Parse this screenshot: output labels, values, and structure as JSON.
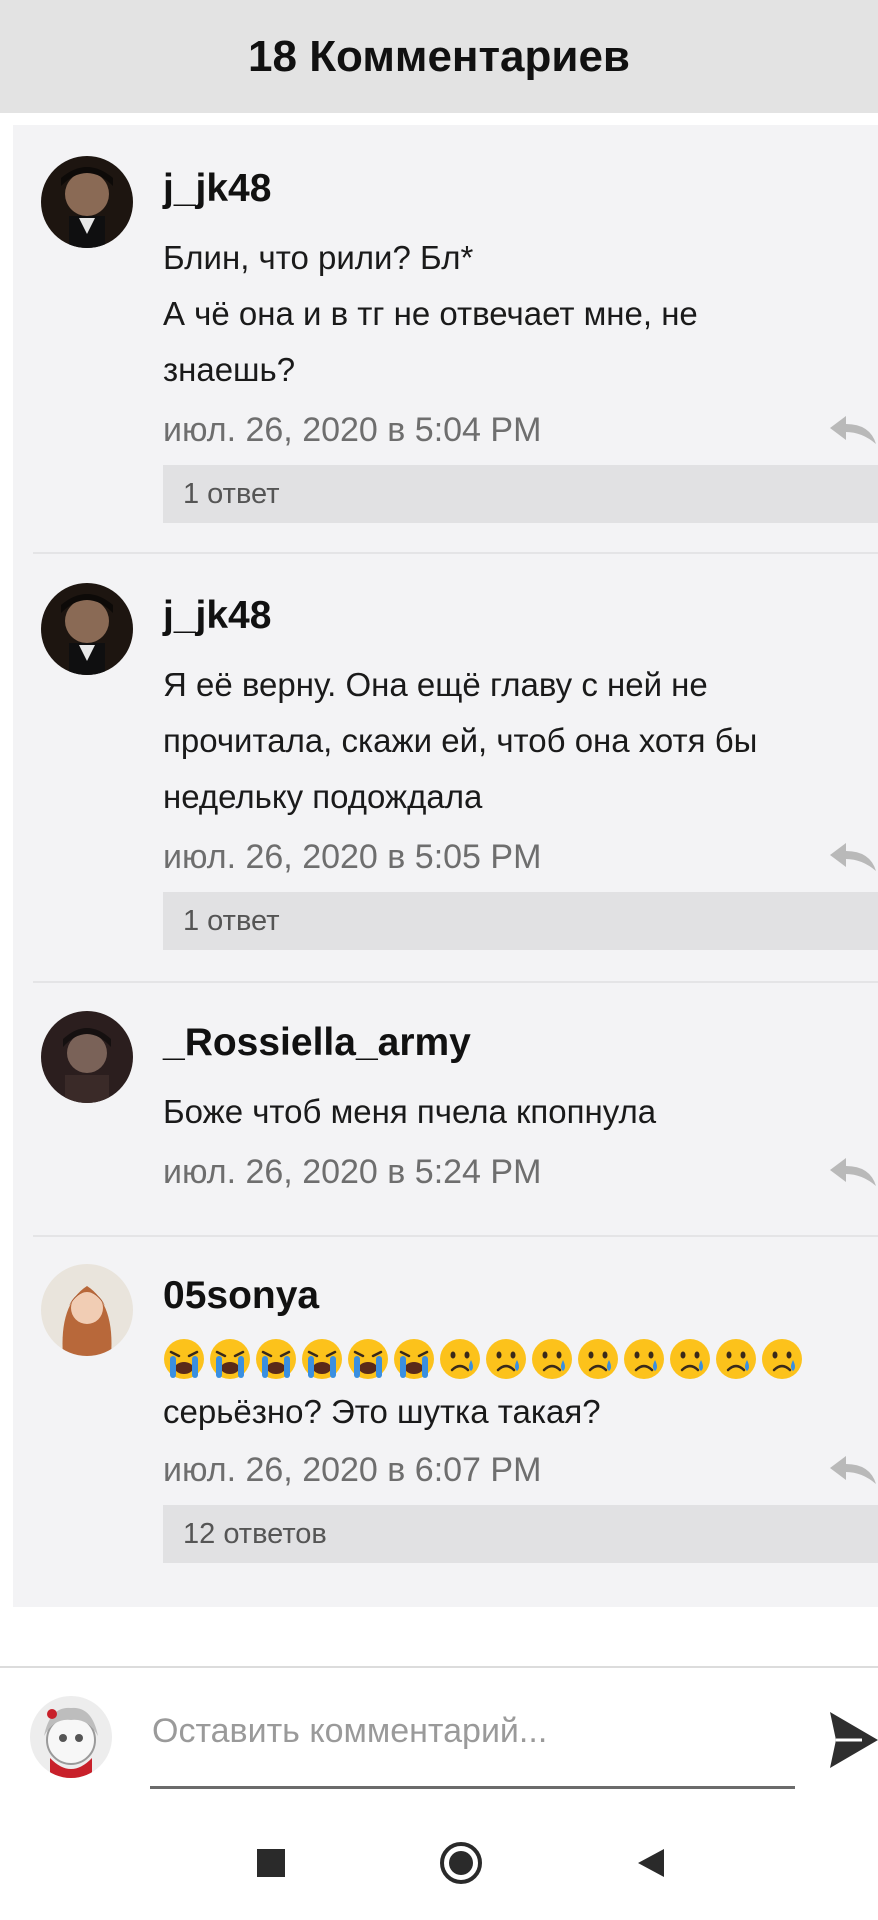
{
  "header": {
    "title": "18 Комментариев"
  },
  "comments": [
    {
      "username": "j_jk48",
      "lines": [
        "Блин, что рили? Бл*",
        "А чё она и в тг не отвечает мне, не",
        "знаешь?"
      ],
      "timestamp": "июл. 26, 2020 в 5:04 PM",
      "replies": "1 ответ"
    },
    {
      "username": "j_jk48",
      "lines": [
        "Я её верну. Она ещё главу с ней не",
        "прочитала, скажи ей, чтоб она хотя бы",
        "недельку подождала"
      ],
      "timestamp": "июл. 26, 2020 в 5:05 PM",
      "replies": "1 ответ"
    },
    {
      "username": "_Rossiella_army",
      "lines": [
        "Боже чтоб меня пчела кпопнула"
      ],
      "timestamp": "июл. 26, 2020 в 5:24 PM"
    },
    {
      "username": "05sonya",
      "emoji_row": [
        "😭",
        "😭",
        "😭",
        "😭",
        "😭",
        "😭",
        "😢",
        "😢",
        "😢",
        "😢",
        "😢",
        "😢",
        "😢",
        "😢"
      ],
      "lines": [
        "серьёзно? Это шутка такая?"
      ],
      "timestamp": "июл. 26, 2020 в 6:07 PM",
      "replies": "12 ответов"
    }
  ],
  "composer": {
    "placeholder": "Оставить комментарий..."
  },
  "icons": {
    "reply": "reply-arrow-icon",
    "send": "send-icon",
    "nav": [
      "recent-apps-icon",
      "home-icon",
      "back-icon"
    ]
  },
  "colors": {
    "header_bg": "#e3e3e3",
    "comment_bg": "#f3f3f5",
    "replies_bg": "#e1e1e3",
    "timestamp": "#6e6e6e"
  }
}
